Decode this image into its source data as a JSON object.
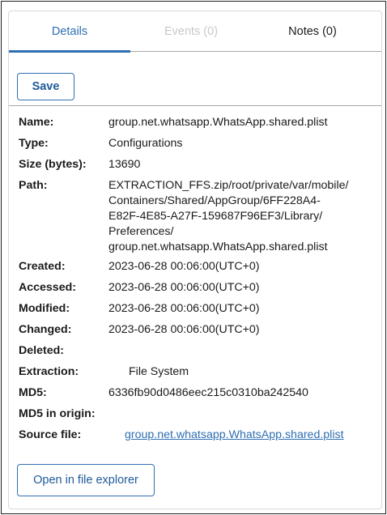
{
  "tabs": [
    {
      "label": "Details",
      "state": "active"
    },
    {
      "label": "Events (0)",
      "state": "disabled"
    },
    {
      "label": "Notes (0)",
      "state": "normal"
    }
  ],
  "save_label": "Save",
  "fields": [
    {
      "label": "Name:",
      "value": "group.net.whatsapp.WhatsApp.shared.plist"
    },
    {
      "label": "Type:",
      "value": "Configurations"
    },
    {
      "label": "Size (bytes):",
      "value": "13690"
    },
    {
      "label": "Path:",
      "value": "EXTRACTION_FFS.zip/root/private/var/mobile/\nContainers/Shared/AppGroup/6FF228A4-\nE82F-4E85-A27F-159687F96EF3/Library/\nPreferences/\ngroup.net.whatsapp.WhatsApp.shared.plist"
    },
    {
      "label": "Created:",
      "value": "2023-06-28 00:06:00(UTC+0)"
    },
    {
      "label": "Accessed:",
      "value": "2023-06-28 00:06:00(UTC+0)"
    },
    {
      "label": "Modified:",
      "value": "2023-06-28 00:06:00(UTC+0)"
    },
    {
      "label": "Changed:",
      "value": "2023-06-28 00:06:00(UTC+0)"
    },
    {
      "label": "Deleted:",
      "value": ""
    },
    {
      "label": "Extraction:",
      "value": "File System"
    },
    {
      "label": "MD5:",
      "value": "6336fb90d0486eec215c0310ba242540"
    },
    {
      "label": "MD5 in origin:",
      "value": ""
    },
    {
      "label": "Source file:",
      "value": "group.net.whatsapp.WhatsApp.shared.plist"
    }
  ],
  "open_explorer_label": "Open in file explorer",
  "colors": {
    "accent": "#2f6fb3",
    "disabled": "#c8c8c8",
    "divider": "#a8a8a8"
  }
}
